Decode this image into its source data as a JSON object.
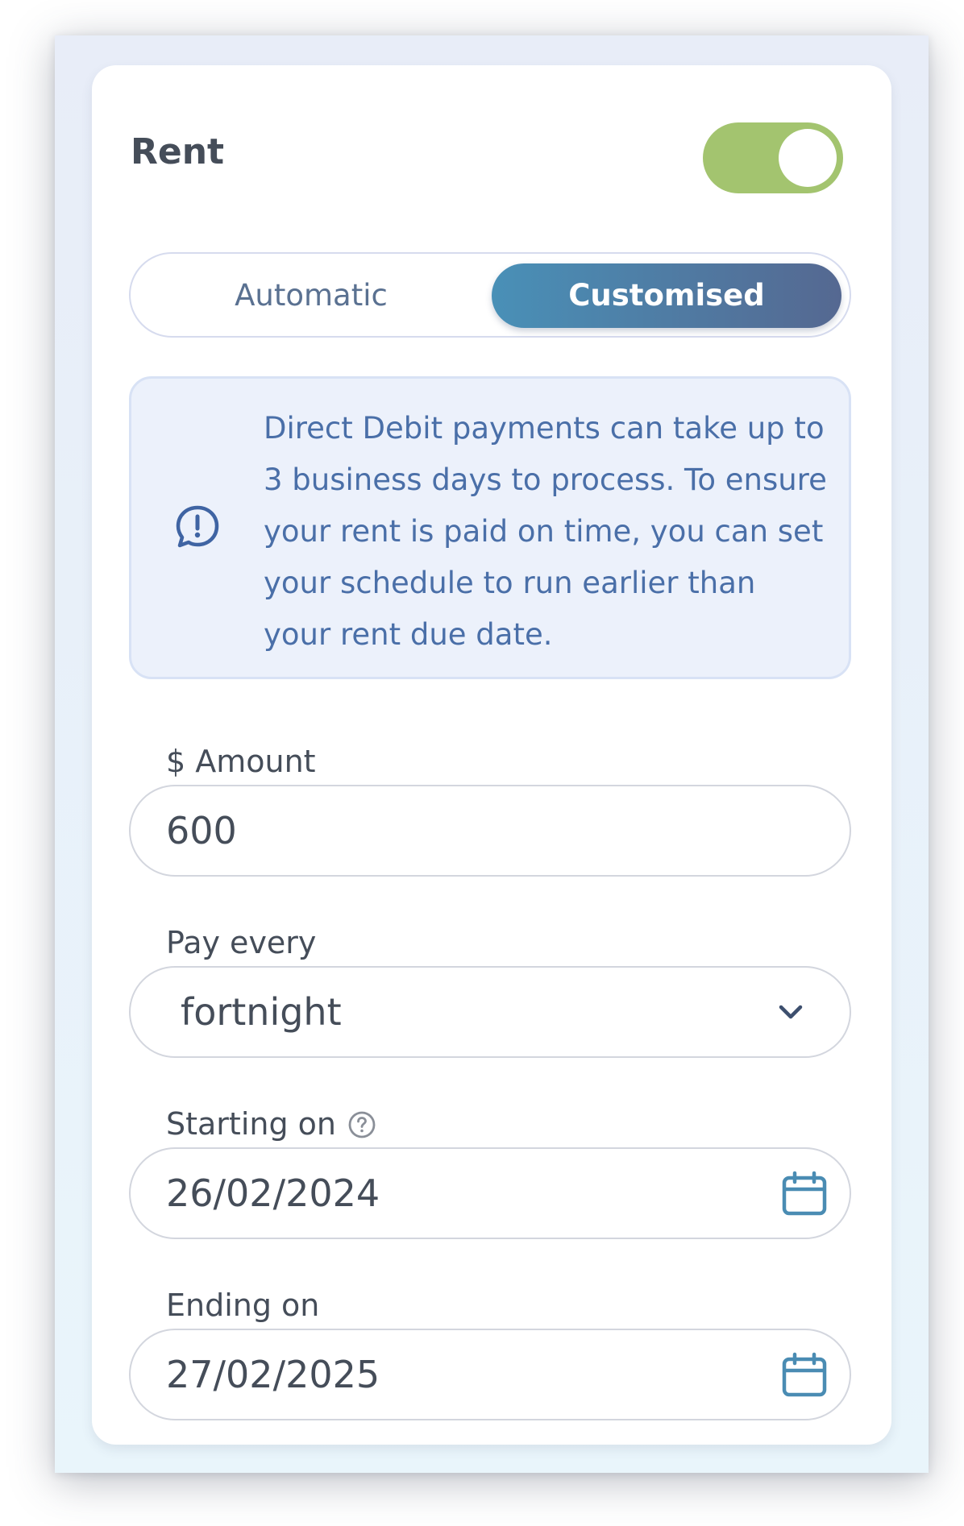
{
  "rent_card": {
    "title": "Rent",
    "enabled": true,
    "mode_tabs": {
      "automatic_label": "Automatic",
      "customised_label": "Customised",
      "selected": "Customised"
    },
    "info_message": "Direct Debit payments can take up to 3 business days to process. To ensure your rent is paid on time, you can set your schedule to run earlier than your rent due date.",
    "amount": {
      "label": "$ Amount",
      "value": "600"
    },
    "frequency": {
      "label": "Pay every",
      "value": "fortnight"
    },
    "start_date": {
      "label": "Starting on",
      "value": "26/02/2024"
    },
    "end_date": {
      "label": "Ending on",
      "value": "27/02/2025"
    }
  },
  "icons": {
    "toggle": "toggle-switch",
    "info": "alert-speech-bubble-icon",
    "dropdown": "chevron-down-icon",
    "help": "question-circle-icon",
    "calendar": "calendar-icon"
  },
  "colors": {
    "toggle_on": "#a3c46f",
    "accent_start": "#4990b7",
    "accent_end": "#556891",
    "info_bg": "#ecf1fb",
    "info_text": "#4a6fa8",
    "calendar_icon": "#4a8cb3"
  }
}
